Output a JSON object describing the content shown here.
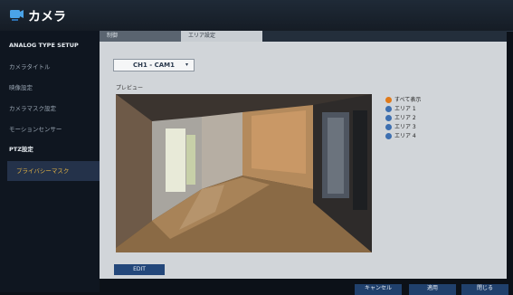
{
  "app": {
    "title": "カメラ",
    "icon": "camera-icon"
  },
  "sidebar": {
    "items": [
      {
        "label": "ANALOG TYPE SETUP"
      },
      {
        "label": "カメラタイトル"
      },
      {
        "label": "映像設定"
      },
      {
        "label": "カメラマスク設定"
      },
      {
        "label": "モーションセンサー"
      },
      {
        "label": "PTZ設定"
      },
      {
        "label": "プライバシーマスク"
      }
    ]
  },
  "tabs": [
    {
      "label": "制御"
    },
    {
      "label": "エリア設定"
    }
  ],
  "camera_select": {
    "value": "CH1 - CAM1"
  },
  "preview": {
    "label": "プレビュー"
  },
  "legend": {
    "items": [
      {
        "label": "すべて表示",
        "color": "#e07a1a"
      },
      {
        "label": "エリア 1",
        "color": "#3d6fb0"
      },
      {
        "label": "エリア 2",
        "color": "#3d6fb0"
      },
      {
        "label": "エリア 3",
        "color": "#3d6fb0"
      },
      {
        "label": "エリア 4",
        "color": "#3d6fb0"
      }
    ]
  },
  "edit_button": {
    "label": "EDIT"
  },
  "footer": {
    "cancel_label": "キャンセル",
    "apply_label": "適用",
    "close_label": "閉じる"
  }
}
